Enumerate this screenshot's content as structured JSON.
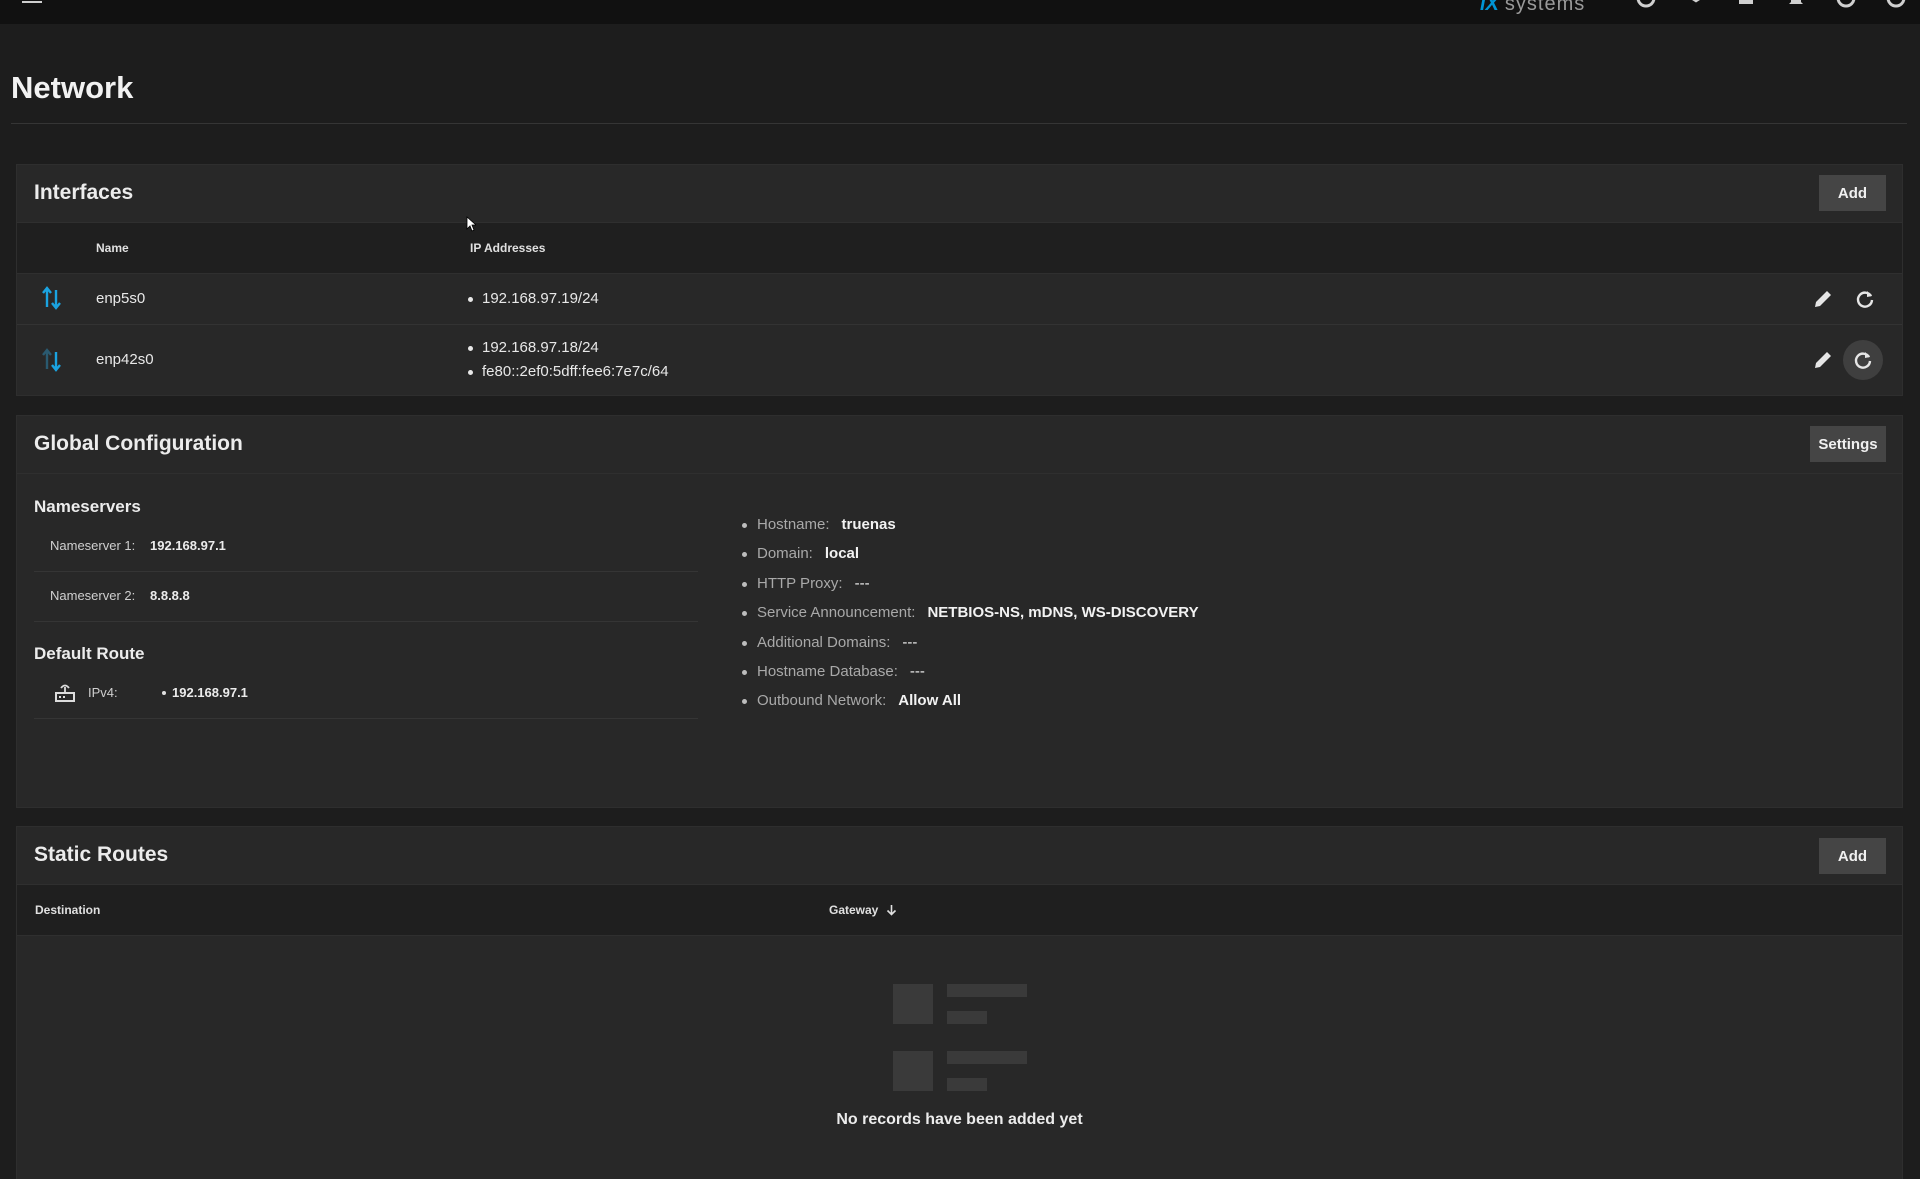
{
  "topbar": {
    "brand_logo": "iX",
    "brand_text": "systems",
    "icons": [
      "truecommand-icon",
      "directory-services-icon",
      "jobs-icon",
      "notifications-icon",
      "user-icon",
      "power-icon"
    ]
  },
  "page": {
    "title": "Network"
  },
  "interfaces": {
    "title": "Interfaces",
    "add_label": "Add",
    "columns": {
      "name": "Name",
      "ip": "IP Addresses"
    },
    "rows": [
      {
        "name": "enp5s0",
        "ips": [
          "192.168.97.19/24"
        ],
        "status_icon": "link-up-down-icon"
      },
      {
        "name": "enp42s0",
        "ips": [
          "192.168.97.18/24",
          "fe80::2ef0:5dff:fee6:7e7c/64"
        ],
        "status_icon": "link-down-icon"
      }
    ]
  },
  "global": {
    "title": "Global Configuration",
    "settings_label": "Settings",
    "nameservers": {
      "title": "Nameservers",
      "items": [
        {
          "label": "Nameserver 1:",
          "value": "192.168.97.1"
        },
        {
          "label": "Nameserver 2:",
          "value": "8.8.8.8"
        }
      ]
    },
    "default_route": {
      "title": "Default Route",
      "label": "IPv4:",
      "value": "192.168.97.1"
    },
    "details": [
      {
        "key": "Hostname:",
        "value": "truenas"
      },
      {
        "key": "Domain:",
        "value": "local"
      },
      {
        "key": "HTTP Proxy:",
        "value": "---"
      },
      {
        "key": "Service Announcement:",
        "value": "NETBIOS-NS, mDNS, WS-DISCOVERY"
      },
      {
        "key": "Additional Domains:",
        "value": "---"
      },
      {
        "key": "Hostname Database:",
        "value": "---"
      },
      {
        "key": "Outbound Network:",
        "value": "Allow All"
      }
    ]
  },
  "static_routes": {
    "title": "Static Routes",
    "add_label": "Add",
    "columns": {
      "destination": "Destination",
      "gateway": "Gateway"
    },
    "empty_text": "No records have been added yet"
  },
  "colors": {
    "accent": "#0095d5",
    "background": "#1d1d1d",
    "card": "#282828",
    "button": "#454545"
  }
}
